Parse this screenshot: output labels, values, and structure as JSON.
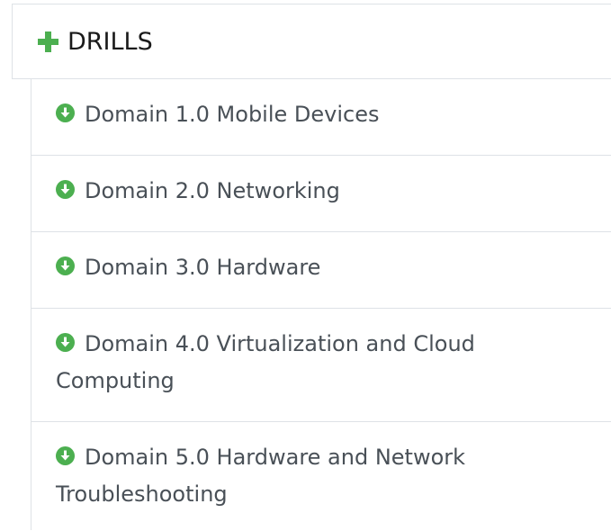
{
  "header": {
    "title": "DRILLS",
    "icon": "plus-icon",
    "icon_color": "#4caf50"
  },
  "items": [
    {
      "label": "Domain 1.0 Mobile Devices",
      "icon": "circle-arrow-down-icon"
    },
    {
      "label": "Domain 2.0 Networking",
      "icon": "circle-arrow-down-icon"
    },
    {
      "label": "Domain 3.0 Hardware",
      "icon": "circle-arrow-down-icon"
    },
    {
      "label": "Domain 4.0 Virtualization and Cloud Computing",
      "icon": "circle-arrow-down-icon"
    },
    {
      "label": "Domain 5.0 Hardware and Network Troubleshooting",
      "icon": "circle-arrow-down-icon"
    }
  ],
  "colors": {
    "accent": "#4caf50",
    "text": "#495057",
    "border": "#dee2e6"
  }
}
